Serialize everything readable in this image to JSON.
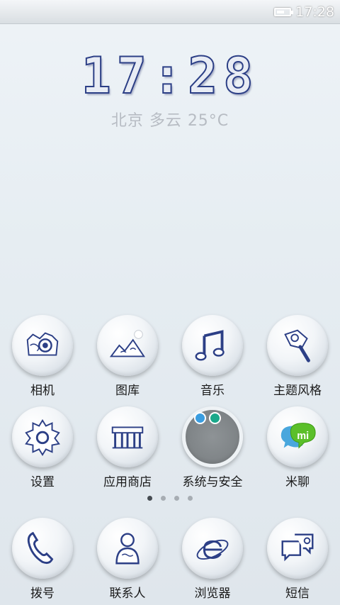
{
  "status": {
    "time": "17:28"
  },
  "clock": {
    "time": "17:28"
  },
  "weather": {
    "text": "北京 多云 25°C"
  },
  "apps_page": [
    {
      "label": "相机",
      "icon": "camera-icon"
    },
    {
      "label": "图库",
      "icon": "gallery-icon"
    },
    {
      "label": "音乐",
      "icon": "music-icon"
    },
    {
      "label": "主题风格",
      "icon": "theme-icon"
    },
    {
      "label": "设置",
      "icon": "settings-icon"
    },
    {
      "label": "应用商店",
      "icon": "app-store-icon"
    },
    {
      "label": "系统与安全",
      "icon": "security-icon"
    },
    {
      "label": "米聊",
      "icon": "miliao-icon",
      "badge": "mi"
    }
  ],
  "dock": [
    {
      "label": "拨号",
      "icon": "phone-icon"
    },
    {
      "label": "联系人",
      "icon": "contacts-icon"
    },
    {
      "label": "浏览器",
      "icon": "browser-icon"
    },
    {
      "label": "短信",
      "icon": "sms-icon"
    }
  ],
  "page_indicator": {
    "count": 4,
    "active_index": 0
  },
  "colors": {
    "porcelain_blue": "#2c3f86",
    "miliao_green": "#5bbf2a"
  }
}
